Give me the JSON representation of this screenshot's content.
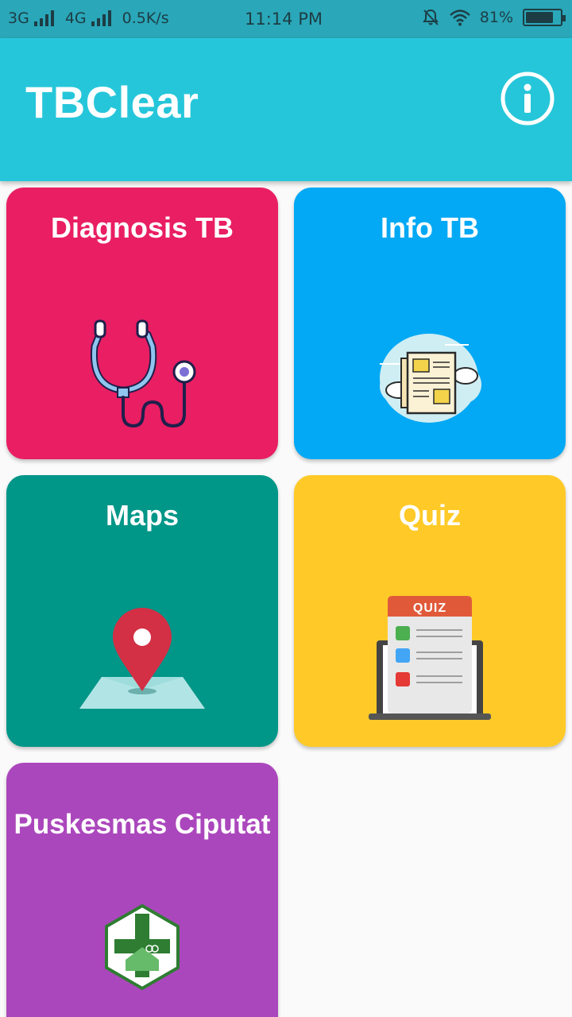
{
  "status_bar": {
    "network_1": "3G",
    "network_2": "4G",
    "speed": "0.5K/s",
    "time": "11:14 PM",
    "battery": "81%",
    "battery_level": 0.81,
    "icons": [
      "signal-icon",
      "mute-icon",
      "wifi-icon",
      "battery-icon"
    ]
  },
  "app_bar": {
    "title": "TBClear",
    "info_icon": "info-icon",
    "background": "#26c6da"
  },
  "menu": [
    {
      "label": "Diagnosis TB",
      "icon": "stethoscope-icon",
      "color": "#e91e63"
    },
    {
      "label": "Info TB",
      "icon": "newspaper-icon",
      "color": "#03a9f4"
    },
    {
      "label": "Maps",
      "icon": "map-pin-icon",
      "color": "#009688"
    },
    {
      "label": "Quiz",
      "icon": "quiz-laptop-icon",
      "color": "#ffca28",
      "icon_text": "QUIZ"
    },
    {
      "label": "Puskesmas Ciputat",
      "icon": "puskesmas-logo-icon",
      "color": "#ab47bc"
    }
  ]
}
